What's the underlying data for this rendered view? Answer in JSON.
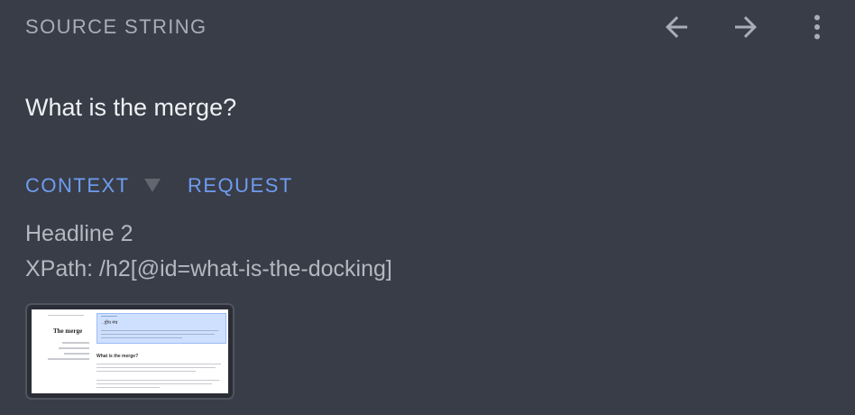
{
  "header": {
    "label": "SOURCE STRING",
    "icons": [
      "arrow-left-icon",
      "arrow-right-icon",
      "more-vert-icon"
    ]
  },
  "source": {
    "text": "What is the merge?"
  },
  "tabs": [
    {
      "label": "CONTEXT",
      "active": true
    },
    {
      "label": "REQUEST",
      "active": false
    }
  ],
  "context": {
    "element": "Headline 2",
    "xpath": "XPath: /h2[@id=what-is-the-docking]"
  },
  "screenshot": {
    "page_title": "The merge",
    "highlight_title": "..ष्ट्रीय मंच",
    "section_title": "What is the merge?"
  },
  "colors": {
    "background": "#393d48",
    "accent": "#6e9cf0",
    "muted": "#a9adb6"
  }
}
